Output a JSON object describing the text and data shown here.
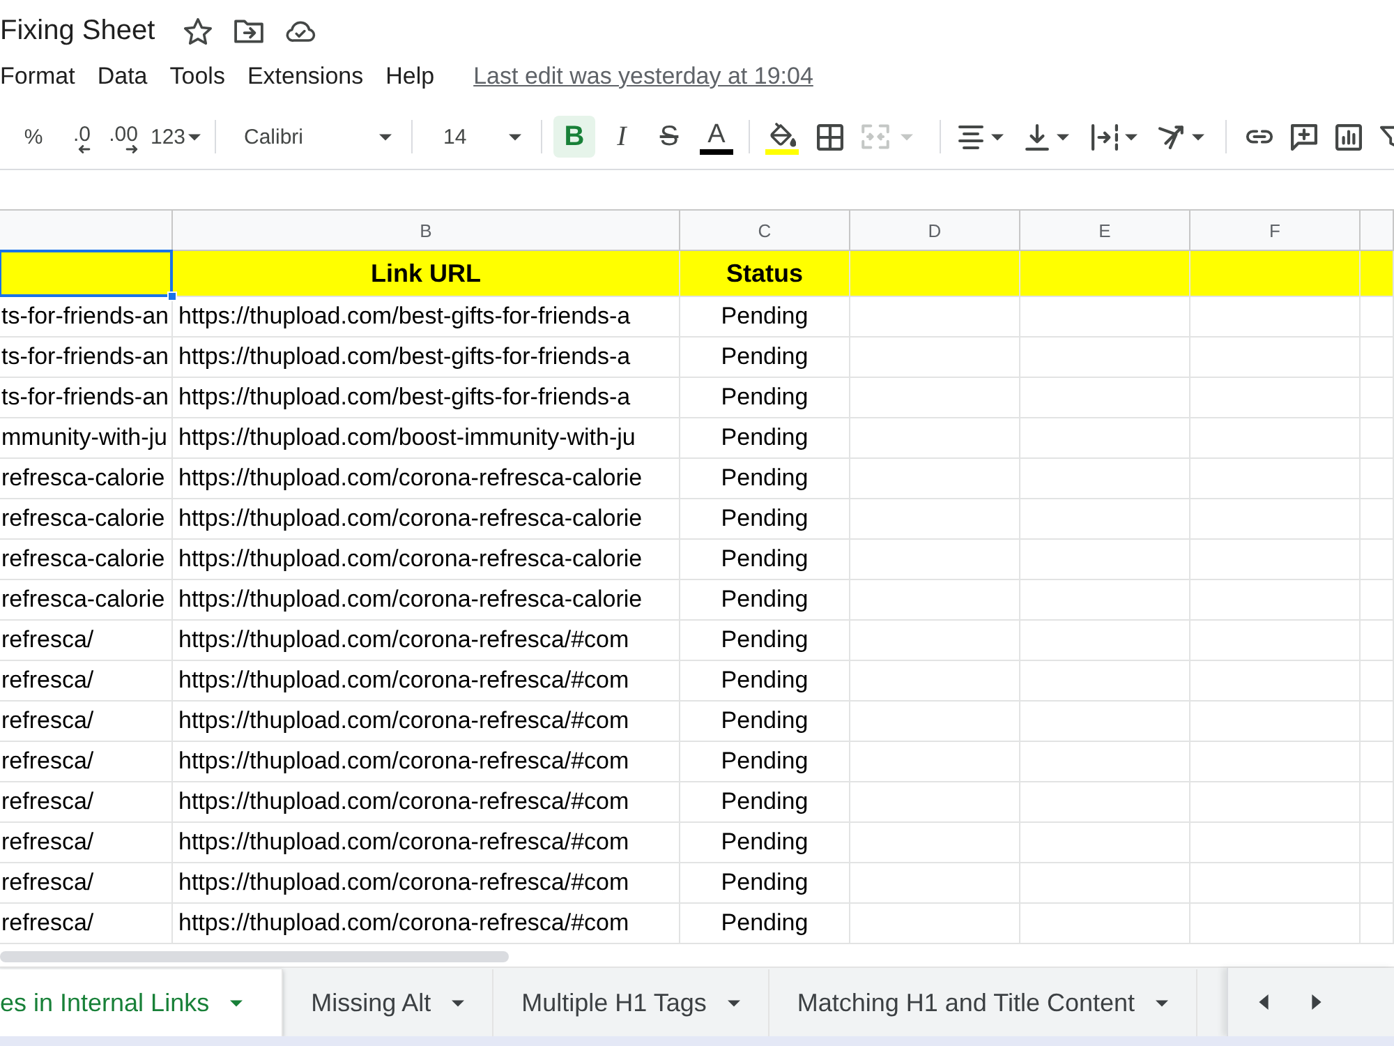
{
  "document": {
    "title": "Fixing Sheet"
  },
  "menu": {
    "items": [
      "Format",
      "Data",
      "Tools",
      "Extensions",
      "Help"
    ],
    "last_edit": "Last edit was yesterday at 19:04"
  },
  "toolbar": {
    "groups": [
      [
        {
          "kind": "percent",
          "label": "%"
        },
        {
          "kind": "decimal-less",
          "label": ".0"
        },
        {
          "kind": "decimal-more",
          "label": ".00"
        },
        {
          "kind": "number-format",
          "label": "123"
        }
      ],
      [
        {
          "kind": "font",
          "value": "Calibri"
        }
      ],
      [
        {
          "kind": "font-size",
          "value": "14"
        }
      ],
      [
        {
          "kind": "bold",
          "label": "B",
          "on": true
        },
        {
          "kind": "italic",
          "label": "I",
          "on": false
        },
        {
          "kind": "strike",
          "label": "S",
          "on": false
        },
        {
          "kind": "text-color",
          "label": "A",
          "color": "#000000"
        }
      ],
      [
        {
          "kind": "fill-color",
          "color": "#ffff00"
        },
        {
          "kind": "borders"
        },
        {
          "kind": "merge",
          "disabled": true
        }
      ],
      [
        {
          "kind": "align"
        },
        {
          "kind": "valign"
        },
        {
          "kind": "wrap"
        },
        {
          "kind": "rotate"
        }
      ],
      [
        {
          "kind": "link"
        },
        {
          "kind": "comment"
        },
        {
          "kind": "chart"
        },
        {
          "kind": "filter"
        }
      ]
    ]
  },
  "grid": {
    "column_headers": [
      "B",
      "C",
      "D",
      "E",
      "F"
    ],
    "header_row": {
      "first_cell_selected": true,
      "cells": [
        "Link URL",
        "Status"
      ]
    },
    "rows": [
      {
        "column_1": "ts-for-friends-an",
        "link_url": "https://thupload.com/best-gifts-for-friends-a",
        "status": "Pending"
      },
      {
        "column_1": "ts-for-friends-an",
        "link_url": "https://thupload.com/best-gifts-for-friends-a",
        "status": "Pending"
      },
      {
        "column_1": "ts-for-friends-an",
        "link_url": "https://thupload.com/best-gifts-for-friends-a",
        "status": "Pending"
      },
      {
        "column_1": "mmunity-with-ju",
        "link_url": "https://thupload.com/boost-immunity-with-ju",
        "status": "Pending"
      },
      {
        "column_1": "refresca-calorie",
        "link_url": "https://thupload.com/corona-refresca-calorie",
        "status": "Pending"
      },
      {
        "column_1": "refresca-calorie",
        "link_url": "https://thupload.com/corona-refresca-calorie",
        "status": "Pending"
      },
      {
        "column_1": "refresca-calorie",
        "link_url": "https://thupload.com/corona-refresca-calorie",
        "status": "Pending"
      },
      {
        "column_1": "refresca-calorie",
        "link_url": "https://thupload.com/corona-refresca-calorie",
        "status": "Pending"
      },
      {
        "column_1": "refresca/",
        "link_url": "https://thupload.com/corona-refresca/#com",
        "status": "Pending"
      },
      {
        "column_1": "refresca/",
        "link_url": "https://thupload.com/corona-refresca/#com",
        "status": "Pending"
      },
      {
        "column_1": "refresca/",
        "link_url": "https://thupload.com/corona-refresca/#com",
        "status": "Pending"
      },
      {
        "column_1": "refresca/",
        "link_url": "https://thupload.com/corona-refresca/#com",
        "status": "Pending"
      },
      {
        "column_1": "refresca/",
        "link_url": "https://thupload.com/corona-refresca/#com",
        "status": "Pending"
      },
      {
        "column_1": "refresca/",
        "link_url": "https://thupload.com/corona-refresca/#com",
        "status": "Pending"
      },
      {
        "column_1": "refresca/",
        "link_url": "https://thupload.com/corona-refresca/#com",
        "status": "Pending"
      },
      {
        "column_1": "refresca/",
        "link_url": "https://thupload.com/corona-refresca/#com",
        "status": "Pending"
      }
    ]
  },
  "sheet_tabs": [
    {
      "label": "es in Internal Links",
      "selected": true
    },
    {
      "label": "Missing Alt",
      "selected": false
    },
    {
      "label": "Multiple H1 Tags",
      "selected": false
    },
    {
      "label": "Matching H1 and Title Content",
      "selected": false
    }
  ]
}
